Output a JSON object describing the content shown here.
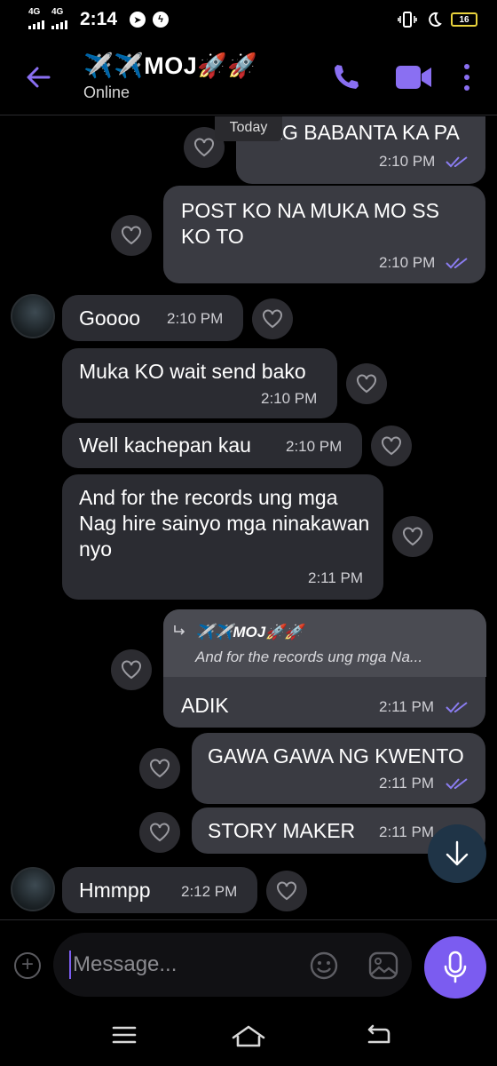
{
  "status_bar": {
    "network_1": "4G",
    "network_2": "4G",
    "time": "2:14",
    "battery": "16"
  },
  "header": {
    "title": "✈️✈️MOJ🚀🚀",
    "status": "Online"
  },
  "chat": {
    "date_divider": "Today",
    "messages": [
      {
        "direction": "out",
        "text": "NAG BABANTA KA PA",
        "time": "2:10 PM",
        "read": true
      },
      {
        "direction": "out",
        "text": "POST KO NA MUKA MO SS KO TO",
        "time": "2:10 PM",
        "read": true
      },
      {
        "direction": "in",
        "text": "Goooo",
        "time": "2:10 PM"
      },
      {
        "direction": "in",
        "text": "Muka KO wait send bako",
        "time": "2:10 PM"
      },
      {
        "direction": "in",
        "text": "Well kachepan kau",
        "time": "2:10 PM"
      },
      {
        "direction": "in",
        "text": "And for the records ung mga Nag hire sainyo mga ninakawan nyo",
        "time": "2:11 PM"
      },
      {
        "direction": "out",
        "reply_to_name": "✈️✈️MOJ🚀🚀",
        "reply_to_text": "And for the records ung mga Na...",
        "text": "ADIK",
        "time": "2:11 PM",
        "read": true
      },
      {
        "direction": "out",
        "text": "GAWA GAWA NG KWENTO",
        "time": "2:11 PM",
        "read": true
      },
      {
        "direction": "out",
        "text": "STORY MAKER",
        "time": "2:11 PM",
        "read": true
      },
      {
        "direction": "in",
        "text": "Hmmpp",
        "time": "2:12 PM"
      }
    ]
  },
  "composer": {
    "placeholder": "Message..."
  },
  "colors": {
    "accent": "#7b5cf0",
    "background": "#000000",
    "incoming_bubble": "#2b2c32",
    "outgoing_bubble": "#3a3b42",
    "read_ticks": "#8a7cf0"
  }
}
